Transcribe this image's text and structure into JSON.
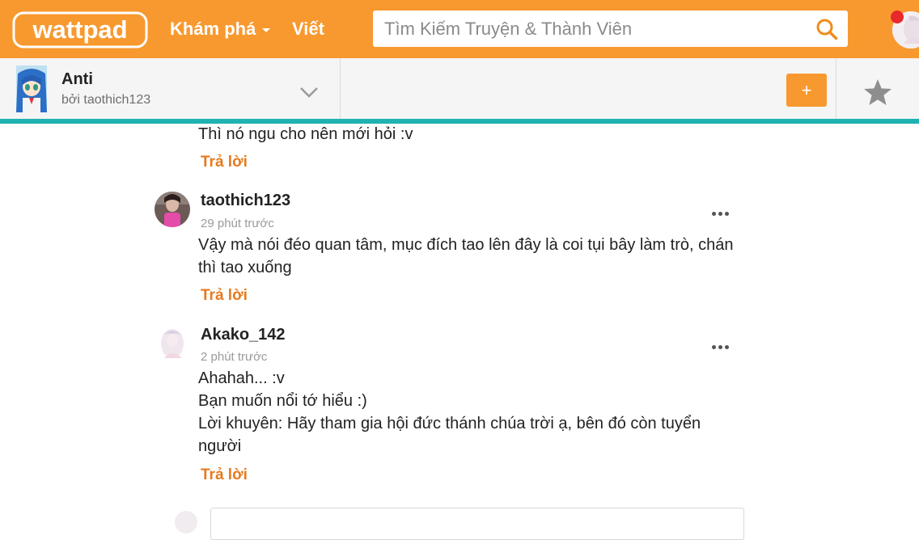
{
  "topbar": {
    "logo_text": "wattpad",
    "discover_label": "Khám phá",
    "write_label": "Viết",
    "search_placeholder": "Tìm Kiếm Truyện & Thành Viên",
    "brand_color": "#f8992f",
    "notification_color": "#e8282b"
  },
  "story": {
    "title": "Anti",
    "author": "bởi taothich123",
    "add_label": "+",
    "accent_line_color": "#1eb2b2"
  },
  "comments": [
    {
      "lines": [
        "Thì nó ngu cho nên mới hỏi :v"
      ],
      "reply_label": "Trả lời"
    },
    {
      "username": "taothich123",
      "time": "29 phút trước",
      "lines": [
        "Vậy mà nói đéo quan tâm, mục đích tao lên đây là coi tụi bây làm trò, chán",
        "thì tao xuống"
      ],
      "reply_label": "Trả lời"
    },
    {
      "username": "Akako_142",
      "time": "2 phút trước",
      "lines": [
        "Ahahah... :v",
        "Bạn muốn nổi tớ hiểu :)",
        "Lời khuyên: Hãy tham gia hội đức thánh chúa trời ạ, bên đó còn tuyển",
        "người"
      ],
      "reply_label": "Trả lời"
    }
  ]
}
